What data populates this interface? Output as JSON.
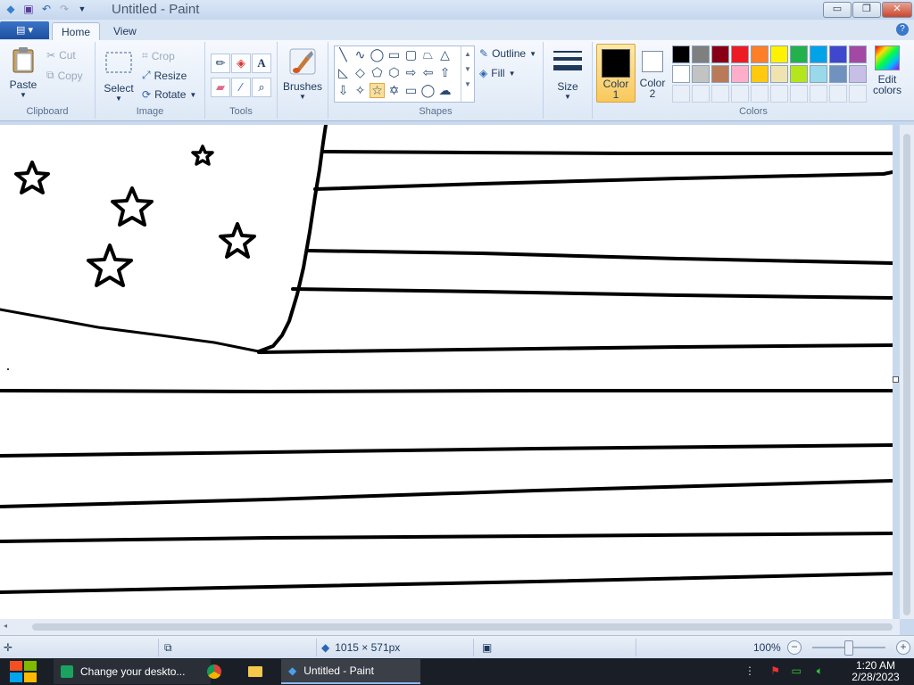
{
  "window": {
    "title": "Untitled - Paint",
    "buttons": {
      "minimize": "▭",
      "maximize": "❐",
      "close": "✕"
    }
  },
  "tabs": {
    "app_menu": "▤ ▾",
    "home": "Home",
    "view": "View",
    "help": "?"
  },
  "ribbon": {
    "clipboard": {
      "label": "Clipboard",
      "paste": "Paste",
      "cut": "Cut",
      "copy": "Copy"
    },
    "image": {
      "label": "Image",
      "select": "Select",
      "crop": "Crop",
      "resize": "Resize",
      "rotate": "Rotate"
    },
    "tools": {
      "label": "Tools"
    },
    "brushes": {
      "label": "Brushes"
    },
    "shapes": {
      "label": "Shapes",
      "outline": "Outline",
      "fill": "Fill"
    },
    "size": {
      "label": "Size"
    },
    "colors": {
      "label": "Colors",
      "color1_label": "Color",
      "color1_num": "1",
      "color2_label": "Color",
      "color2_num": "2",
      "edit": "Edit",
      "edit2": "colors",
      "row1": [
        "#000000",
        "#7f7f7f",
        "#880015",
        "#ed1c24",
        "#ff7f27",
        "#fff200",
        "#22b14c",
        "#00a2e8",
        "#3f48cc",
        "#a349a4"
      ],
      "row2": [
        "#ffffff",
        "#c3c3c3",
        "#b97a57",
        "#ffaec9",
        "#ffc90e",
        "#efe4b0",
        "#b5e61d",
        "#99d9ea",
        "#7092be",
        "#c8bfe7"
      ]
    }
  },
  "status": {
    "dimensions": "1015 × 571px",
    "zoom": "100%"
  },
  "taskbar": {
    "items": [
      {
        "label": "Change your deskto..."
      },
      {
        "label": ""
      },
      {
        "label": ""
      },
      {
        "label": "Untitled - Paint"
      }
    ],
    "time": "1:20 AM",
    "date": "2/28/2023"
  }
}
